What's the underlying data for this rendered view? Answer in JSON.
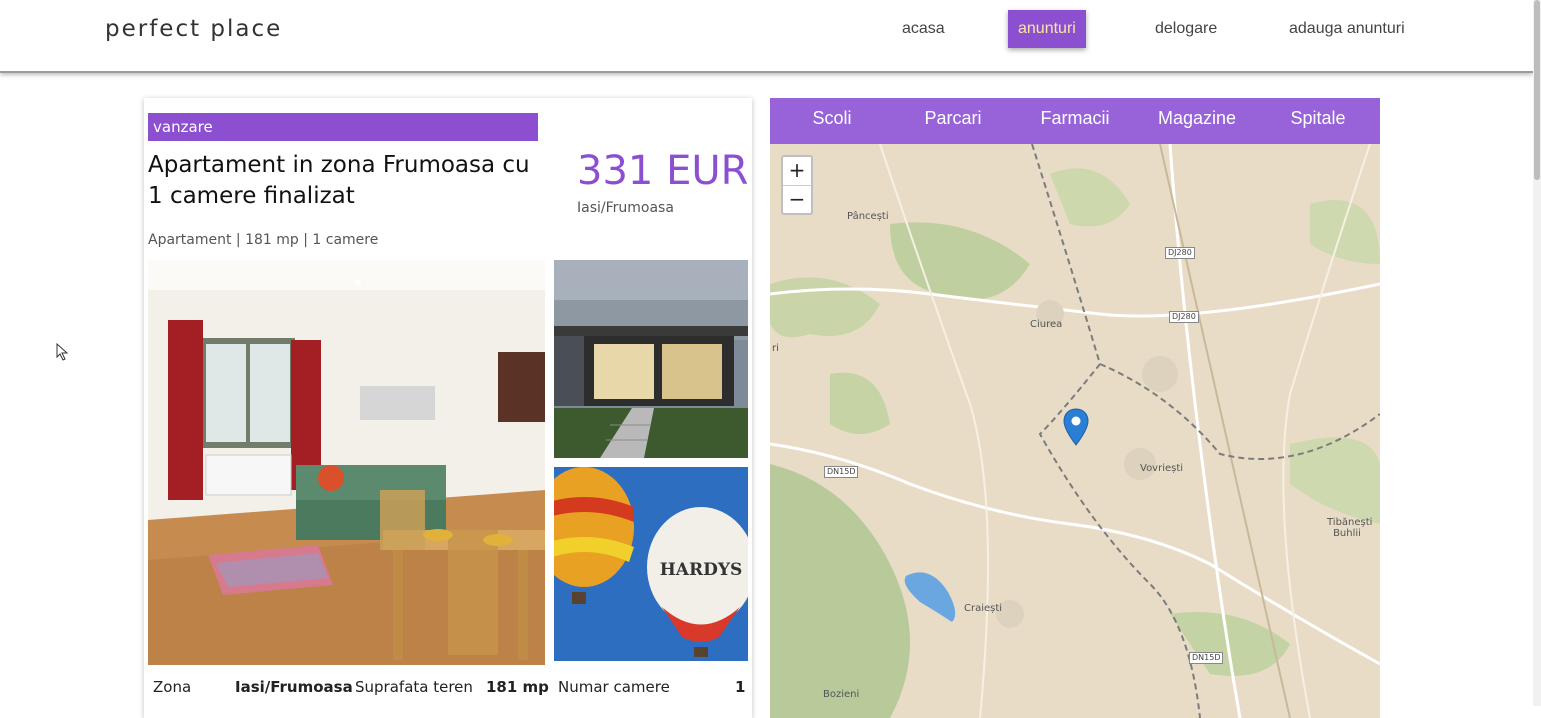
{
  "header": {
    "brand": "perfect place",
    "nav": [
      "acasa",
      "anunturi",
      "delogare",
      "adauga anunturi"
    ],
    "active_nav": "anunturi"
  },
  "listing": {
    "badge": "vanzare",
    "title": "Apartament in zona Frumoasa cu 1 camere finalizat",
    "price": "331 EUR",
    "location": "Iasi/Frumoasa",
    "meta": "Apartament | 181 mp | 1 camere",
    "details": {
      "zona_label": "Zona",
      "zona_value": "Iasi/Frumoasa",
      "suprafata_label": "Suprafata teren",
      "suprafata_value": "181 mp",
      "camere_label": "Numar camere",
      "camere_value": "1"
    }
  },
  "map": {
    "tabs": [
      "Scoli",
      "Parcari",
      "Farmacii",
      "Magazine",
      "Spitale"
    ],
    "zoom_in": "+",
    "zoom_out": "−",
    "places": [
      "Pâncești",
      "Ciurea",
      "Vovriești",
      "Tibănești Buhlii",
      "Craiești",
      "Bozieni",
      "ri"
    ],
    "roads": [
      "DJ280",
      "DJ280",
      "DN15D",
      "DN15D"
    ]
  },
  "colors": {
    "accent": "#8c4fd0",
    "tabs_bg": "#9862d9",
    "active_nav_text": "#f6e6a8",
    "map_bg": "#e8dcc6",
    "marker": "#2a7fd4"
  }
}
